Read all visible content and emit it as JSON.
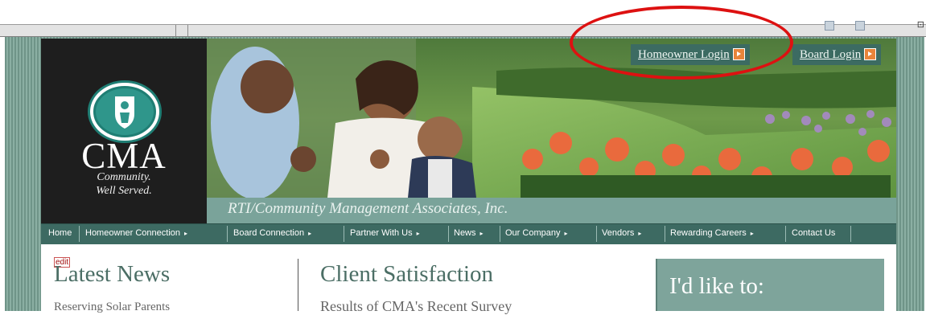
{
  "site": {
    "logo": {
      "name": "CMA",
      "tagline_line1": "Community.",
      "tagline_line2": "Well Served."
    },
    "tagline": "RTI/Community Management Associates, Inc.",
    "login_buttons": [
      {
        "label": "Homeowner Login"
      },
      {
        "label": "Board Login"
      }
    ],
    "nav": [
      {
        "label": "Home",
        "has_dropdown": false
      },
      {
        "label": "Homeowner Connection",
        "has_dropdown": true
      },
      {
        "label": "Board Connection",
        "has_dropdown": true
      },
      {
        "label": "Partner With Us",
        "has_dropdown": true
      },
      {
        "label": "News",
        "has_dropdown": true
      },
      {
        "label": "Our Company",
        "has_dropdown": true
      },
      {
        "label": "Vendors",
        "has_dropdown": true
      },
      {
        "label": "Rewarding Careers",
        "has_dropdown": true
      },
      {
        "label": "Contact Us",
        "has_dropdown": false
      }
    ],
    "nav_arrow": "▸",
    "latest_news": {
      "edit_label": "edit",
      "title": "Latest News",
      "subtitle": "Reserving Solar Parents"
    },
    "client_satisfaction": {
      "title": "Client Satisfaction",
      "subtitle": "Results of CMA's Recent Survey"
    },
    "id_like_to": {
      "title": "I'd like to:"
    }
  },
  "colors": {
    "accent": "#3d6a62",
    "sage": "#7ea49b",
    "highlight": "#dd1111",
    "button_arrow": "#e8843a"
  },
  "icons": [
    "shield-emblem-icon",
    "arrow-right-icon",
    "dropdown-arrow-icon"
  ]
}
